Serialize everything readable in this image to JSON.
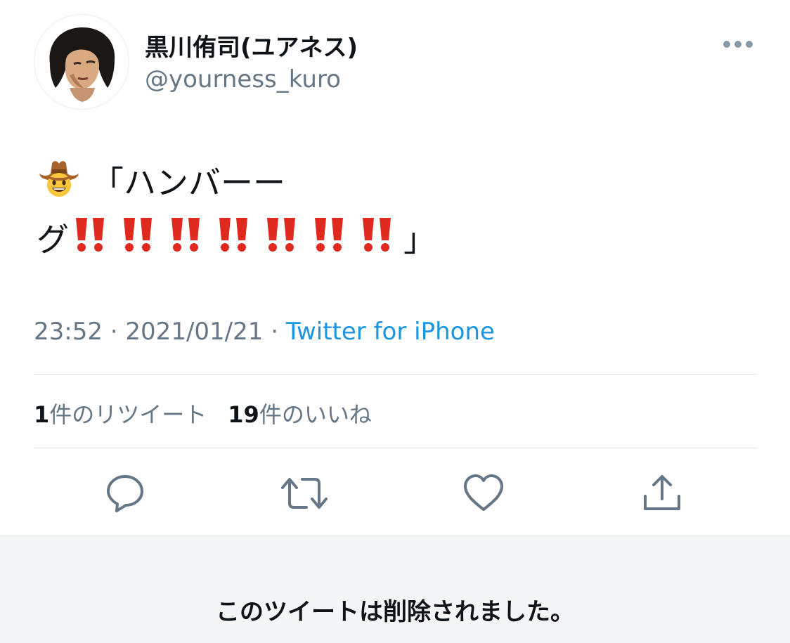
{
  "author": {
    "display_name": "黒川侑司(ユアネス)",
    "handle": "@yourness_kuro",
    "avatar_icon": "avatar-photo"
  },
  "tweet": {
    "line1": "「ハンバーー",
    "line2_start": "グ",
    "line2_end": "」",
    "leading_emoji": "cowboy-hat-face-emoji",
    "emphasis_emoji": "double-exclamation-mark-emoji",
    "emphasis_count": 7,
    "time": "23:52",
    "date": "2021/01/21",
    "sep": " · ",
    "source": "Twitter for iPhone"
  },
  "stats": {
    "retweet_count": "1",
    "retweet_label": "件のリツイート",
    "like_count": "19",
    "like_label": "件のいいね"
  },
  "actions": {
    "reply_icon": "reply-icon",
    "retweet_icon": "retweet-icon",
    "like_icon": "heart-icon",
    "share_icon": "share-icon"
  },
  "notice": {
    "deleted_text": "このツイートは削除されました。"
  },
  "colors": {
    "text": "#0f1419",
    "secondary": "#657786",
    "link": "#1b95e0",
    "icon": "#657786",
    "bang_red": "#e0291f",
    "footer_bg": "#f4f5f7"
  }
}
